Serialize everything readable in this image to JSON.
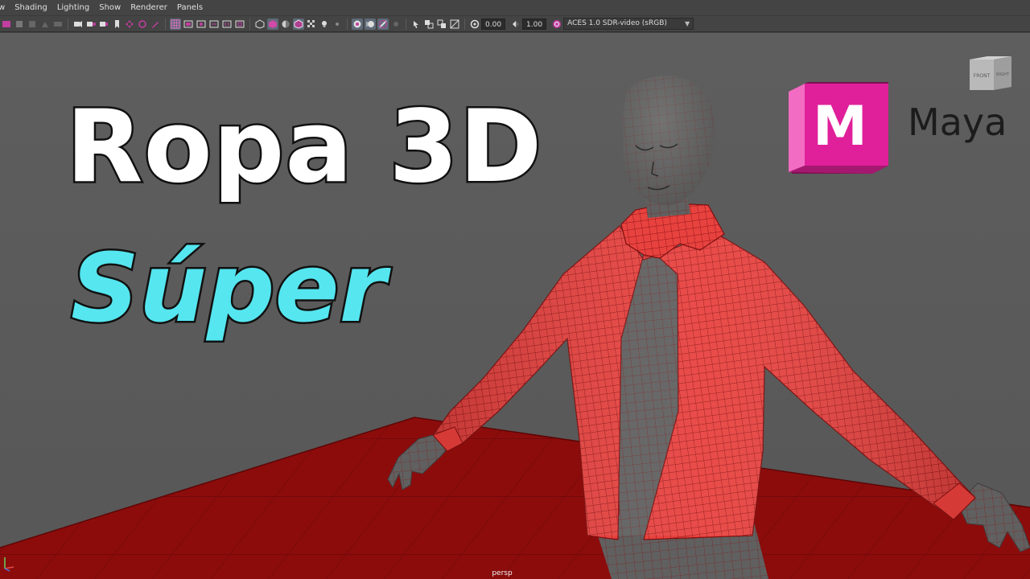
{
  "menu": {
    "items": [
      "w",
      "Shading",
      "Lighting",
      "Show",
      "Renderer",
      "Panels"
    ]
  },
  "toolbar": {
    "exposure_value": "0.00",
    "gamma_value": "1.00",
    "color_space": "ACES 1.0 SDR-video (sRGB)"
  },
  "overlay": {
    "title_line1": "Ropa 3D",
    "title_line2": "Súper",
    "logo_letter": "M",
    "logo_word": "Maya"
  },
  "viewcube": {
    "front": "FRONT",
    "right": "RIGHT"
  },
  "viewport": {
    "camera_label": "persp"
  },
  "colors": {
    "viewport_bg": "#5c5c5c",
    "floor": "#8c0c0c",
    "jacket": "#e8423f",
    "body": "#5f5f5f",
    "title_accent": "#55e6f0",
    "logo_pink": "#e0209a"
  }
}
